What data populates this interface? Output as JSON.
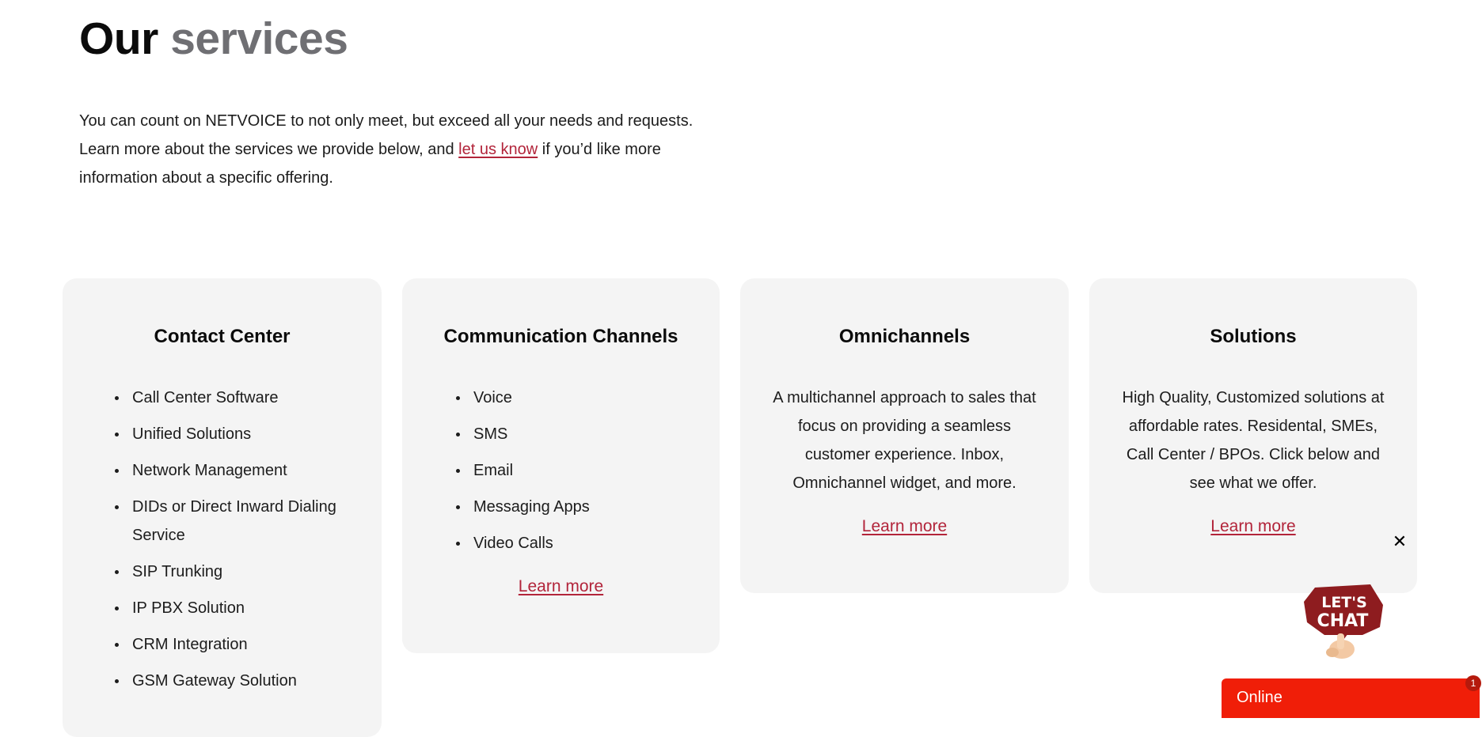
{
  "heading": {
    "part1": "Our",
    "part2": "services"
  },
  "intro": {
    "before_link": "You can count on NETVOICE to not only meet, but exceed all your needs and requests. Learn more about the services we provide below, and ",
    "link_text": "let us know",
    "after_link": " if you’d like more information about a specific offering."
  },
  "cards": [
    {
      "title": "Contact Center",
      "items": [
        "Call Center Software",
        "Unified Solutions",
        "Network Management",
        "DIDs or Direct Inward Dialing Service",
        "SIP Trunking",
        "IP PBX Solution",
        "CRM Integration",
        "GSM Gateway Solution"
      ]
    },
    {
      "title": "Communication Channels",
      "items": [
        "Voice",
        "SMS",
        "Email",
        "Messaging Apps",
        "Video Calls"
      ],
      "link": "Learn more"
    },
    {
      "title": "Omnichannels",
      "description": "A multichannel approach to sales that focus on providing a seamless customer experience. Inbox, Omnichannel widget, and more.",
      "link": "Learn more"
    },
    {
      "title": "Solutions",
      "description": "High Quality, Customized solutions at affordable rates.  Residental, SMEs, Call Center / BPOs. Click below and see what we offer.",
      "link": "Learn more"
    }
  ],
  "chat": {
    "close_glyph": "✕",
    "badge_line1": "LET'S",
    "badge_line2": "CHAT",
    "online_label": "Online",
    "notification_count": "1"
  },
  "colors": {
    "accent_link": "#b2243a",
    "card_bg": "#f4f4f4",
    "online_bar": "#f01e08",
    "chat_badge": "#8e1c1f",
    "heading_secondary": "#6f6f73"
  },
  "icons": [
    "close-icon",
    "chat-bubble-icon",
    "hand-icon"
  ]
}
